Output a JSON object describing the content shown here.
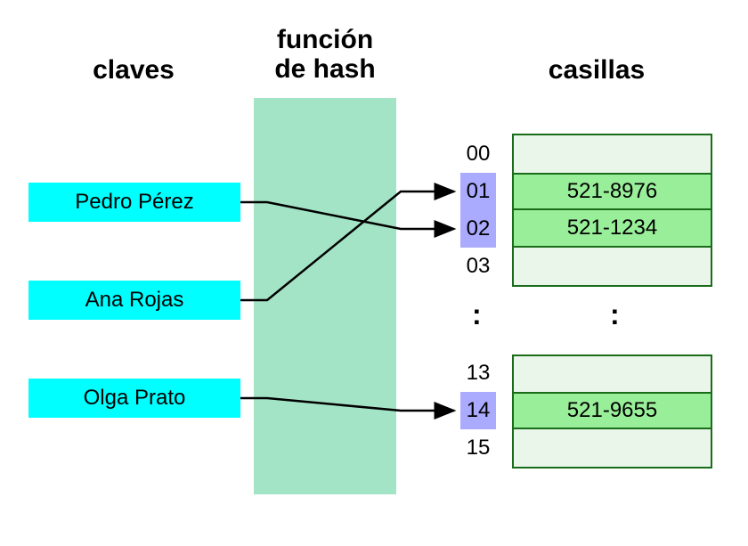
{
  "headings": {
    "claves": "claves",
    "hash": "función\nde hash",
    "casillas": "casillas"
  },
  "keys": [
    {
      "name": "Pedro Pérez"
    },
    {
      "name": "Ana Rojas"
    },
    {
      "name": "Olga Prato"
    }
  ],
  "indices_top": [
    "00",
    "01",
    "02",
    "03"
  ],
  "indices_bot": [
    "13",
    "14",
    "15"
  ],
  "highlighted_indices": [
    "01",
    "02",
    "14"
  ],
  "buckets": {
    "01": "521-8976",
    "02": "521-1234",
    "14": "521-9655"
  },
  "ellipsis": ":",
  "arrows": [
    {
      "from_key": 0,
      "to_index": "02"
    },
    {
      "from_key": 1,
      "to_index": "01"
    },
    {
      "from_key": 2,
      "to_index": "14"
    }
  ],
  "colors": {
    "key_bg": "#00ffff",
    "hash_bg": "#a3e4c6",
    "index_highlight": "#aaaaff",
    "bucket_frame_bg": "#e9f6e9",
    "bucket_fill": "#99ee99",
    "bucket_border": "#1a6b1a"
  }
}
